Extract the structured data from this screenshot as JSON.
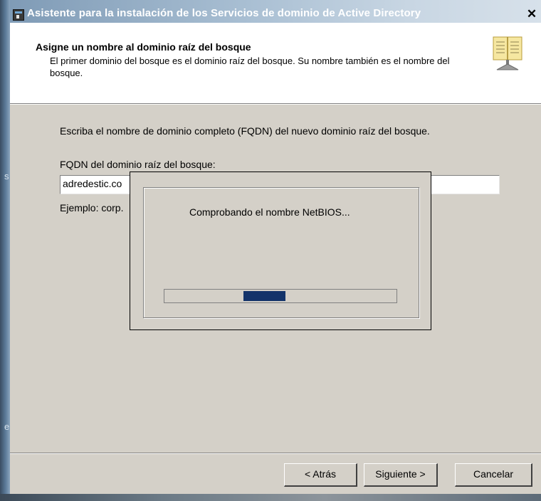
{
  "window": {
    "title": "Asistente para la instalación de los Servicios de dominio de Active Directory",
    "close_glyph": "✕"
  },
  "header": {
    "title": "Asigne un nombre al dominio raíz del bosque",
    "subtitle": "El primer dominio del bosque es el dominio raíz del bosque. Su nombre también es el nombre del bosque."
  },
  "body": {
    "instruction": "Escriba el nombre de dominio completo (FQDN) del nuevo dominio raíz del bosque.",
    "fqdn_label": "FQDN del dominio raíz del bosque:",
    "fqdn_value": "adredestic.co",
    "example": "Ejemplo: corp."
  },
  "progress": {
    "message": "Comprobando el nombre NetBIOS...",
    "bar_color": "#13336a"
  },
  "buttons": {
    "back": "< Atrás",
    "next": "Siguiente >",
    "cancel": "Cancelar"
  },
  "edge_glyphs": [
    "s",
    "e"
  ],
  "icons": {
    "window": "wizard-window-icon",
    "header": "open-book-icon"
  }
}
